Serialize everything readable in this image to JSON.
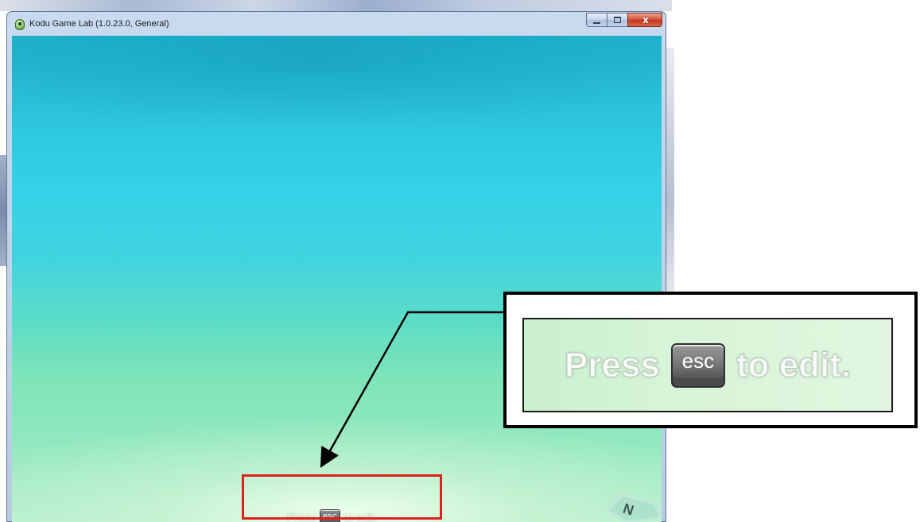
{
  "window": {
    "title": "Kodu Game Lab (1.0.23.0, General)",
    "controls": {
      "minimize": "minimize",
      "maximize": "maximize",
      "close": "x"
    }
  },
  "game_view": {
    "prompt": {
      "before": "Press",
      "key": "esc",
      "after": "to edit."
    },
    "compass_label": "N"
  },
  "callout": {
    "zoom_prompt": {
      "before": "Press",
      "key": "esc",
      "after": "to edit."
    }
  },
  "colors": {
    "highlight": "#e0201c",
    "sky_top": "#1fb1cb",
    "sky_bottom": "#b6efcd"
  }
}
